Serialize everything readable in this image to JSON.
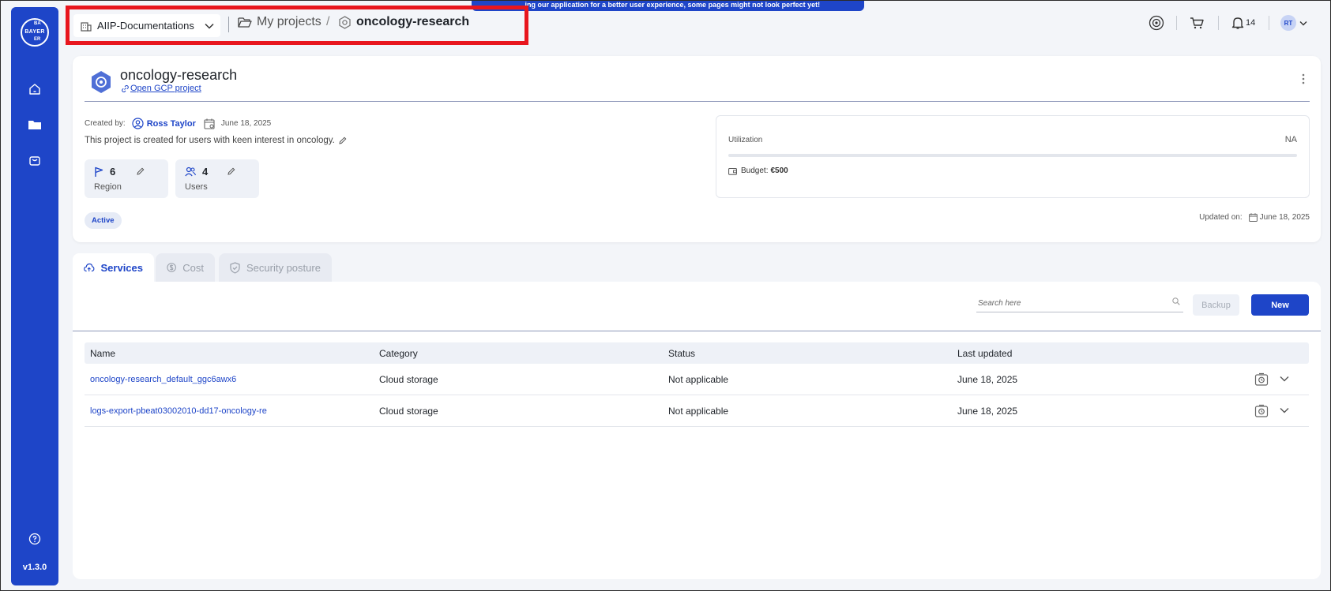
{
  "sidebar": {
    "logo_text_h": "BAYER",
    "logo_text_v_top": "BA",
    "logo_text_v_bottom": "ER",
    "items": [
      {
        "name": "home",
        "icon": "home-icon"
      },
      {
        "name": "projects",
        "icon": "folder-icon"
      },
      {
        "name": "marketplace",
        "icon": "bag-icon"
      }
    ],
    "help_icon": "help-icon",
    "version": "v1.3.0"
  },
  "topbar": {
    "workspace": "AIIP-Documentations",
    "breadcrumb": {
      "projects": "My projects",
      "separator": "/",
      "current": "oncology-research"
    },
    "banner": "...ing our application for a better user experience, some pages might not look perfect yet!",
    "notifications_count": "14",
    "avatar_initials": "RT"
  },
  "project": {
    "title": "oncology-research",
    "gcp_link": "Open GCP project",
    "created_by_label": "Created by:",
    "created_by": "Ross Taylor",
    "created_date": "June 18, 2025",
    "description": "This project is created for users with keen interest in oncology.",
    "stats": [
      {
        "value": "6",
        "label": "Region"
      },
      {
        "value": "4",
        "label": "Users"
      }
    ],
    "status": "Active",
    "utilization_label": "Utilization",
    "utilization_value": "NA",
    "budget_label": "Budget:",
    "budget_value": "€500",
    "updated_label": "Updated on:",
    "updated_date": "June 18, 2025"
  },
  "tabs": [
    {
      "label": "Services",
      "active": true
    },
    {
      "label": "Cost",
      "active": false
    },
    {
      "label": "Security posture",
      "active": false
    }
  ],
  "services": {
    "search_placeholder": "Search here",
    "backup_label": "Backup",
    "new_label": "New",
    "columns": [
      "Name",
      "Category",
      "Status",
      "Last updated"
    ],
    "rows": [
      {
        "name": "oncology-research_default_ggc6awx6",
        "category": "Cloud storage",
        "status": "Not applicable",
        "updated": "June 18, 2025"
      },
      {
        "name": "logs-export-pbeat03002010-dd17-oncology-re",
        "category": "Cloud storage",
        "status": "Not applicable",
        "updated": "June 18, 2025"
      }
    ]
  },
  "colors": {
    "brand": "#1e45c8",
    "highlight": "#e8161e",
    "background": "#f3f5f9"
  }
}
